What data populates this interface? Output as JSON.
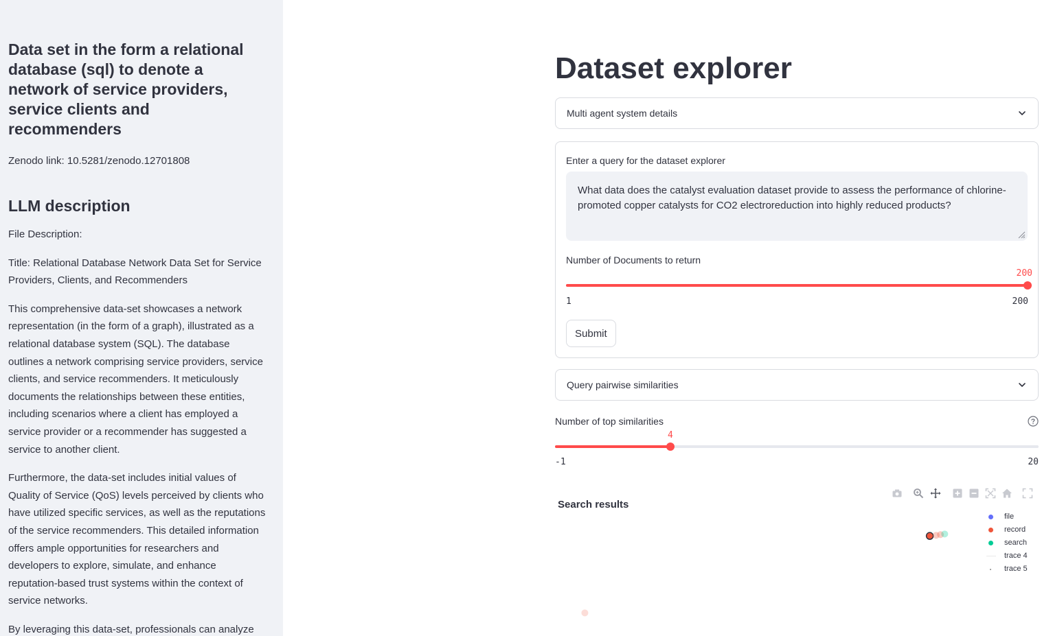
{
  "sidebar": {
    "title": "Data set in the form a relational database (sql) to denote a network of service providers, service clients and recommenders",
    "zenodo": "Zenodo link: 10.5281/zenodo.12701808",
    "llm_heading": "LLM description",
    "paragraphs": [
      "File Description:",
      "Title: Relational Database Network Data Set for Service Providers, Clients, and Recommenders",
      "This comprehensive data-set showcases a network representation (in the form of a graph), illustrated as a relational database system (SQL). The database outlines a network comprising service providers, service clients, and service recommenders. It meticulously documents the relationships between these entities, including scenarios where a client has employed a service provider or a recommender has suggested a service to another client.",
      "Furthermore, the data-set includes initial values of Quality of Service (QoS) levels perceived by clients who have utilized specific services, as well as the reputations of the service recommenders. This detailed information offers ample opportunities for researchers and developers to explore, simulate, and enhance reputation-based trust systems within the context of service networks.",
      "By leveraging this data-set, professionals can analyze patterns, derive insights, and possibly refine algorithms"
    ]
  },
  "main": {
    "title": "Dataset explorer",
    "expander1": "Multi agent system details",
    "query_label": "Enter a query for the dataset explorer",
    "query_value": "What data does the catalyst evaluation dataset provide to assess the performance of chlorine-promoted copper catalysts for CO2 electroreduction into highly reduced products?",
    "docs_label": "Number of Documents to return",
    "docs_slider": {
      "min": "1",
      "max": "200",
      "value": "200",
      "fraction": 1.0
    },
    "submit": "Submit",
    "expander2": "Query pairwise similarities",
    "top_label": "Number of top similarities",
    "top_slider": {
      "min": "-1",
      "max": "20",
      "value": "4",
      "fraction": 0.238
    },
    "chart_title": "Search results"
  },
  "icons": {
    "chevron": "chevron-down-icon",
    "help": "help-circle-icon",
    "toolbar": [
      "camera-icon",
      "zoom-icon",
      "pan-icon",
      "zoom-in-icon",
      "zoom-out-icon",
      "autoscale-icon",
      "reset-axes-icon",
      "fullscreen-icon"
    ]
  },
  "colors": {
    "accent": "#ff4b4b",
    "file": "#636efa",
    "record": "#ef553b",
    "search": "#00cc96",
    "sidebar_bg": "#f0f2f6"
  },
  "chart_data": {
    "type": "scatter",
    "title": "Search results",
    "legend": [
      {
        "name": "file",
        "color": "#636efa",
        "marker": "dot"
      },
      {
        "name": "record",
        "color": "#ef553b",
        "marker": "dot"
      },
      {
        "name": "search",
        "color": "#00cc96",
        "marker": "dot"
      },
      {
        "name": "trace 4",
        "color": "#cccccc",
        "marker": "line"
      },
      {
        "name": "trace 5",
        "color": "#888888",
        "marker": "small-dot"
      }
    ],
    "points": [
      {
        "series": "record",
        "x": 0.88,
        "y": 0.78,
        "opacity": 1.0,
        "highlight": true
      },
      {
        "series": "record",
        "x": 0.895,
        "y": 0.785,
        "opacity": 0.3
      },
      {
        "series": "record",
        "x": 0.905,
        "y": 0.79,
        "opacity": 0.3
      },
      {
        "series": "search",
        "x": 0.915,
        "y": 0.795,
        "opacity": 0.3
      },
      {
        "series": "record",
        "x": 0.07,
        "y": 0.18,
        "opacity": 0.2
      }
    ],
    "xlim": [
      0,
      1
    ],
    "ylim": [
      0,
      1
    ],
    "legend_position": "top-right"
  }
}
